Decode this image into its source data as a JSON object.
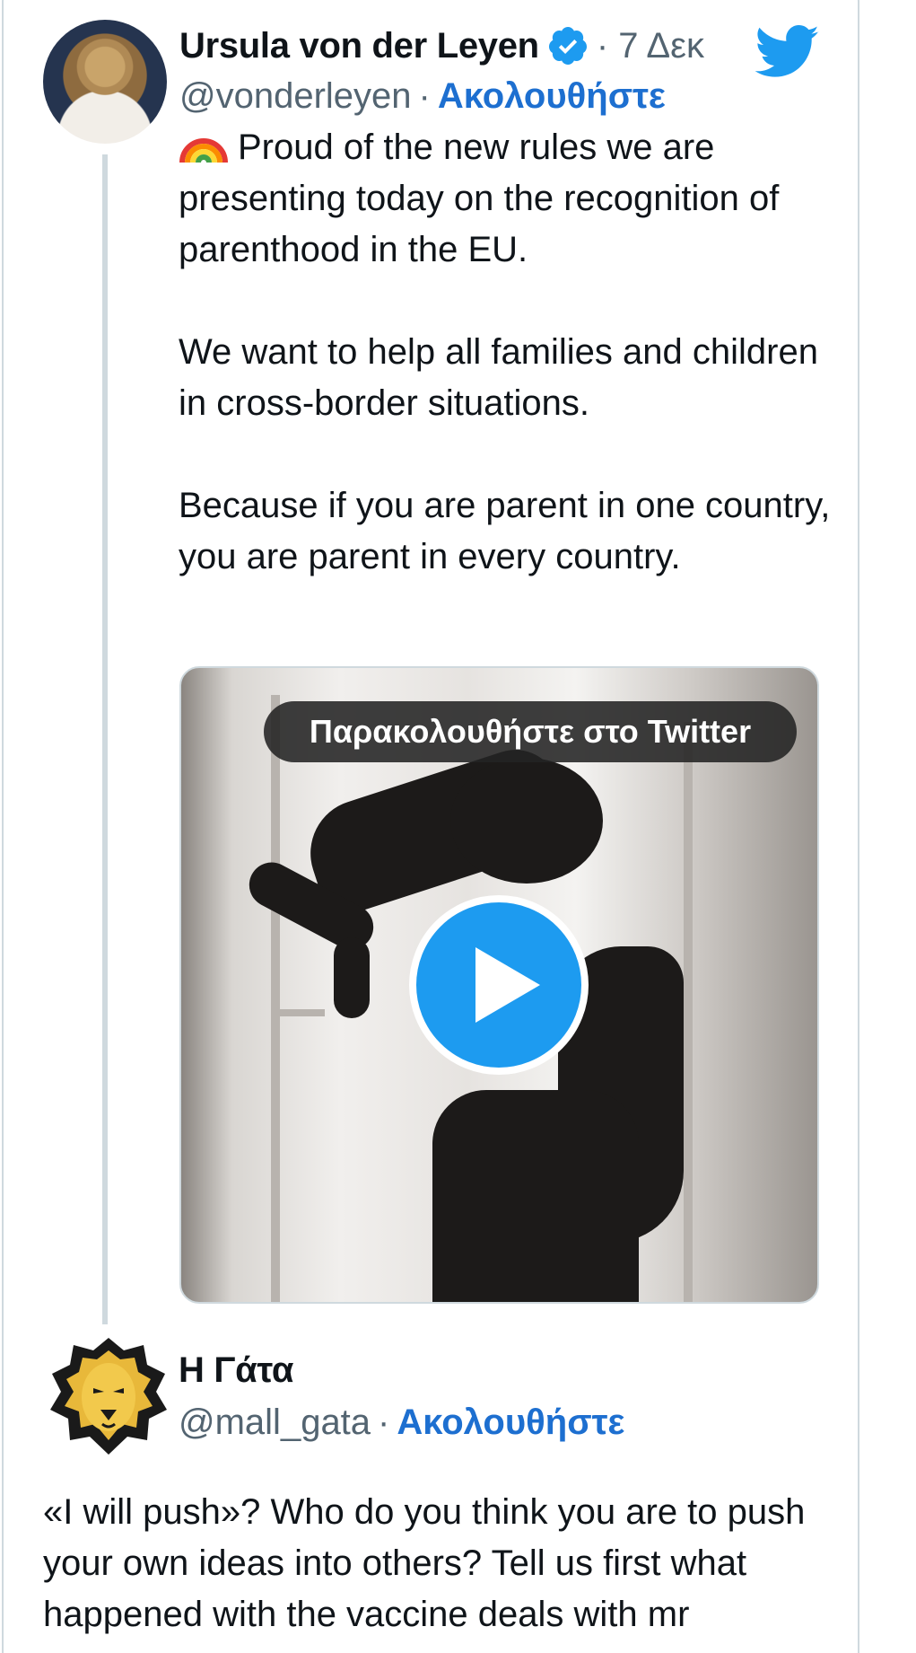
{
  "tweet": {
    "display_name": "Ursula von der Leyen",
    "time": "· 7 Δεκ",
    "handle": "@vonderleyen",
    "separator": "·",
    "follow_label": "Ακολουθήστε",
    "text_paragraphs": [
      "Proud of the new rules we are presenting today on the recognition of parenthood in the EU.",
      "We want to help all families and children in cross-border situations.",
      "Because if you are parent in one country, you are parent in every country."
    ],
    "media": {
      "watch_label": "Παρακολουθήστε στο Twitter"
    }
  },
  "reply": {
    "display_name": "Η Γάτα",
    "handle": "@mall_gata",
    "separator": "·",
    "follow_label": "Ακολουθήστε",
    "text": "«I will push»? Who do you think you are to push your own ideas into others? Tell us first what happened with the vaccine deals with mr"
  },
  "colors": {
    "link": "#1d6fd0",
    "twitter_blue": "#1d9bf0",
    "muted": "#536471",
    "border": "#cfd9de"
  },
  "icons": [
    "verified-badge-icon",
    "twitter-bird-icon",
    "rainbow-emoji-icon",
    "play-icon"
  ]
}
